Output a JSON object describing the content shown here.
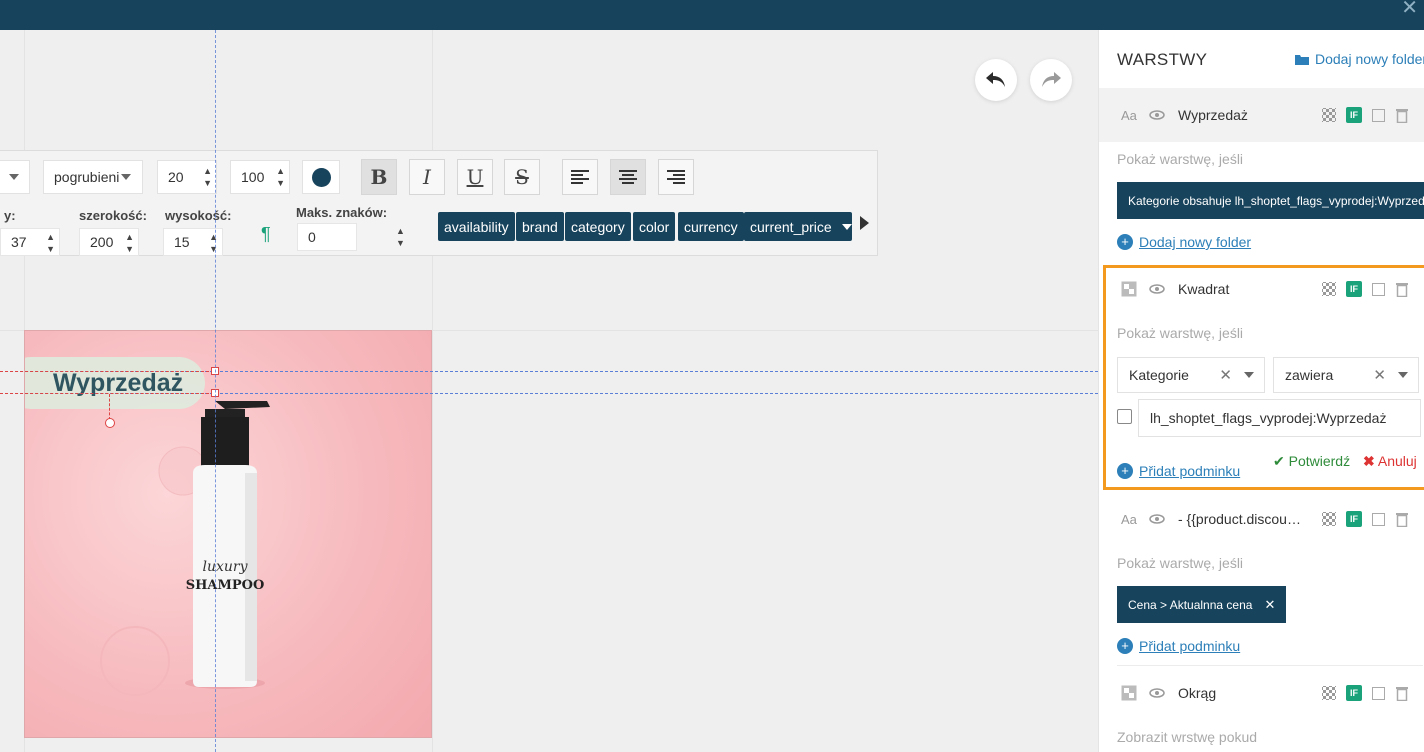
{
  "window": {
    "close_glyph": "✕"
  },
  "toolbar": {
    "font_weight": "pogrubieni",
    "font_size": "20",
    "line_height": "100",
    "color": "#17435c",
    "labels": {
      "y": "y:",
      "width": "szerokość:",
      "height": "wysokość:",
      "max_chars": "Maks. znaków:"
    },
    "values": {
      "y": "37",
      "width": "200",
      "height": "15",
      "max_chars": "0"
    },
    "format_buttons": [
      "B",
      "I",
      "U",
      "S"
    ],
    "variables": [
      "availability",
      "brand",
      "category",
      "color",
      "currency",
      "current_price"
    ]
  },
  "canvas": {
    "sale_text": "Wyprzedaż",
    "product_label_line1": "luxury",
    "product_label_line2": "SHAMPOO"
  },
  "panel": {
    "title": "WARSTWY",
    "add_folder": "Dodaj nowy folder",
    "layers": [
      {
        "name": "Wyprzedaż",
        "type": "text",
        "show_if": "Pokaż warstwę, jeśli",
        "condition": "Kategorie obsahuje lh_shoptet_flags_vyprodej:Wyprzedaż",
        "link": "Dodaj nowy folder"
      },
      {
        "name": "Kwadrat",
        "type": "shape",
        "show_if": "Pokaż warstwę, jeśli",
        "field": "Kategorie",
        "operator": "zawiera",
        "value": "lh_shoptet_flags_vyprodej:Wyprzedaż",
        "add_condition": "Přidat podminku",
        "confirm": "Potwierdź",
        "cancel": "Anuluj"
      },
      {
        "name": "- {{product.discount...",
        "type": "text",
        "show_if": "Pokaż warstwę, jeśli",
        "condition": "Cena > Aktualnna cena",
        "add_condition": "Přidat podminku"
      },
      {
        "name": "Okrąg",
        "type": "shape",
        "show_if": "Zobrazit wrstwę pokud"
      }
    ]
  }
}
